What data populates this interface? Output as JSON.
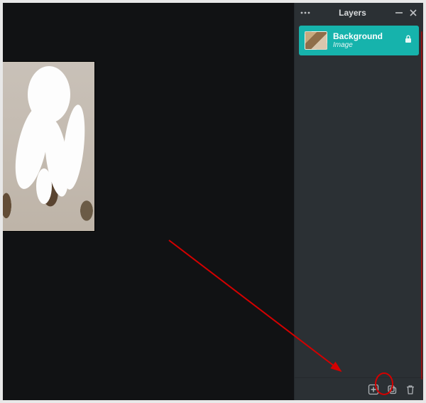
{
  "panel": {
    "title": "Layers"
  },
  "layers": [
    {
      "name": "Background",
      "type": "Image",
      "locked": true
    }
  ],
  "colors": {
    "accent": "#16b3ac",
    "sidebar_bg": "#2b3034",
    "canvas_bg": "#111214",
    "annotation": "#d40000"
  }
}
